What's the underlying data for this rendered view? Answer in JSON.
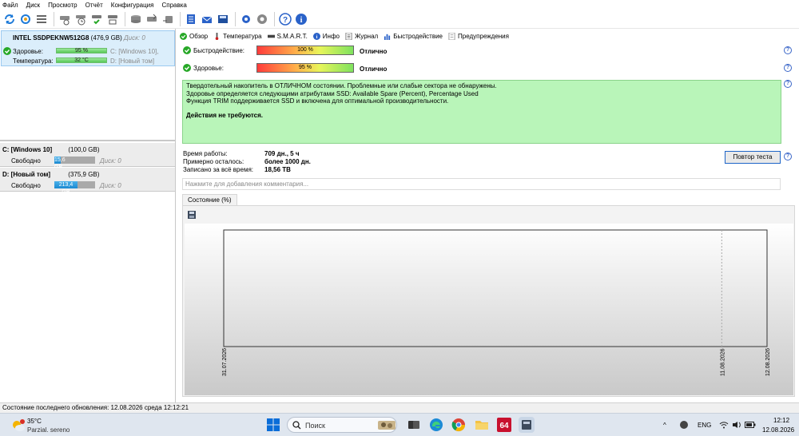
{
  "menu": [
    "Файл",
    "Диск",
    "Просмотр",
    "Отчёт",
    "Конфигурация",
    "Справка"
  ],
  "drive": {
    "model": "INTEL SSDPEKNW512G8",
    "size": "(476,9 GB)",
    "disk_label": "Диск: 0",
    "health_label": "Здоровье:",
    "health_value": "95 %",
    "temp_label": "Температура:",
    "temp_value": "32 °C",
    "part_c": "C: [Windows 10],",
    "part_d": "D: [Новый том]"
  },
  "partitions": [
    {
      "name": "C: [Windows 10]",
      "size": "(100,0 GB)",
      "free_label": "Свободно",
      "free": "15,6 GB",
      "free_fraction": 0.156,
      "disk": "Диск: 0"
    },
    {
      "name": "D: [Новый том]",
      "size": "(375,9 GB)",
      "free_label": "Свободно",
      "free": "213,4 GB",
      "free_fraction": 0.568,
      "disk": "Диск: 0"
    }
  ],
  "tabs": [
    {
      "label": "Обзор",
      "icon": "check-icon"
    },
    {
      "label": "Температура",
      "icon": "thermometer-icon"
    },
    {
      "label": "S.M.A.R.T.",
      "icon": "smart-icon"
    },
    {
      "label": "Инфо",
      "icon": "info-icon"
    },
    {
      "label": "Журнал",
      "icon": "log-icon"
    },
    {
      "label": "Быстродействие",
      "icon": "performance-icon"
    },
    {
      "label": "Предупреждения",
      "icon": "warnings-icon"
    }
  ],
  "status": {
    "performance_label": "Быстродействие:",
    "performance_value": "100 %",
    "performance_text": "Отлично",
    "health_label": "Здоровье:",
    "health_value": "95 %",
    "health_text": "Отлично"
  },
  "info_lines": [
    "Твердотельный накопитель в ОТЛИЧНОМ состоянии. Проблемные или слабые сектора не обнаружены.",
    "Здоровье определяется следующими атрибутами SSD: Available Spare (Percent), Percentage Used",
    "Функция TRIM поддерживается SSD и включена для оптимальной производительности."
  ],
  "info_action": "Действия не требуются.",
  "stats": [
    {
      "label": "Время работы:",
      "value": "709 дн., 5 ч"
    },
    {
      "label": "Примерно осталось:",
      "value": "более 1000 дн."
    },
    {
      "label": "Записано за всё время:",
      "value": "18,56 TB"
    }
  ],
  "retest_label": "Повтор теста",
  "comment_placeholder": "Нажмите для добавления комментария...",
  "chart_tab": "Состояние (%)",
  "chart_data": {
    "type": "line",
    "title": "",
    "x": [
      "31.07.2026",
      "11.08.2026",
      "12.08.2026"
    ],
    "x_days": [
      0,
      11,
      12
    ],
    "series": [
      {
        "values": [
          95,
          95,
          95
        ],
        "color": "#1f2fa8"
      }
    ],
    "y_tick": "95",
    "ylim": [
      0,
      100
    ]
  },
  "statusbar": "Состояние последнего обновления: 12.08.2026 среда 12:12:21",
  "taskbar": {
    "temp": "35°C",
    "weather": "Parzial. sereno",
    "search": "Поиск",
    "lang": "ENG",
    "time": "12:12",
    "date": "12.08.2026"
  },
  "colors": {
    "accent": "#1e65c8",
    "good": "#58c958",
    "infobox": "#b9f5b9"
  }
}
